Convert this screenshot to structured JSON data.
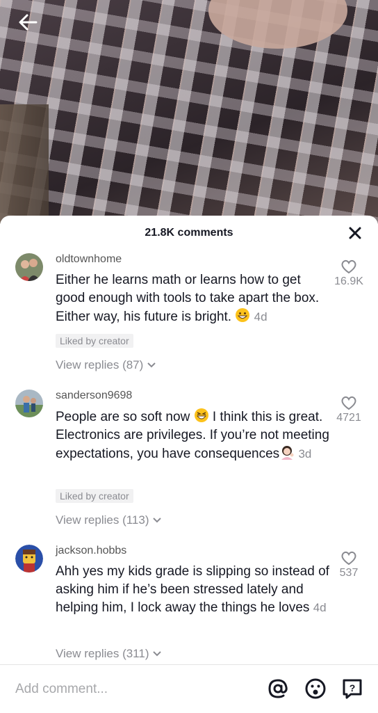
{
  "video": {
    "back_icon": "arrow-left-icon"
  },
  "sheet": {
    "title": "21.8K comments",
    "close_icon": "close-icon"
  },
  "comments": [
    {
      "username": "oldtownhome",
      "text": "Either he learns math or learns how to get good enough with tools to take apart the box. Either way, his future is bright.",
      "emoji": "grinning-face",
      "time": "4d",
      "liked_label": "Liked by creator",
      "replies": "View replies (87)",
      "likes": "16.9K"
    },
    {
      "username": "sanderson9698",
      "text_a": "People are so soft now",
      "emoji_a": "grinning-squinting-face",
      "text_b": "I think this is great. Electronics are privileges. If you’re not meeting expectations, you have consequences",
      "emoji_b": "woman-tipping-hand",
      "time": "3d",
      "liked_label": "Liked by creator",
      "replies": "View replies (113)",
      "likes": "4721"
    },
    {
      "username": "jackson.hobbs",
      "text": "Ahh yes my kids grade is slipping so instead of asking him if he’s been stressed lately and helping him, I lock away the things he loves",
      "time": "4d",
      "replies": "View replies (311)",
      "likes": "537"
    }
  ],
  "bottom": {
    "placeholder": "Add comment...",
    "icons": [
      "at-icon",
      "emoji-icon",
      "report-icon"
    ]
  }
}
